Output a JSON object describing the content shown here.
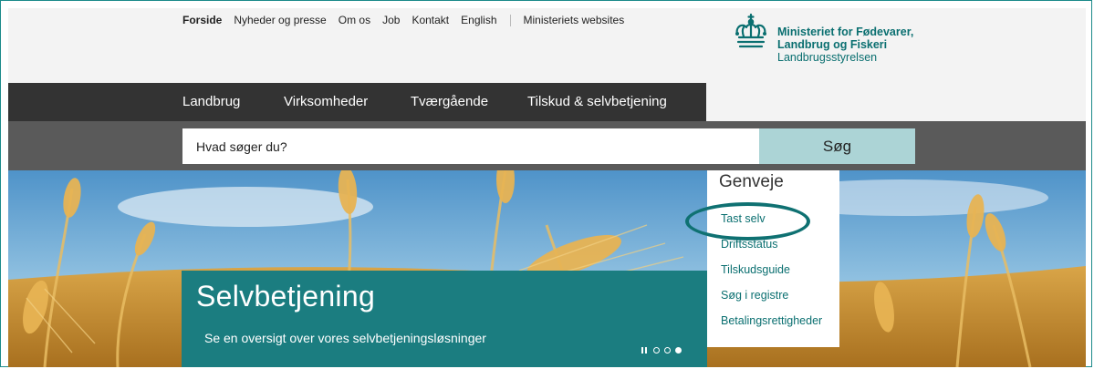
{
  "top_nav": {
    "items": [
      "Forside",
      "Nyheder og presse",
      "Om os",
      "Job",
      "Kontakt",
      "English"
    ],
    "external": "Ministeriets websites"
  },
  "logo": {
    "line1": "Ministeriet for Fødevarer,",
    "line2": "Landbrug og Fiskeri",
    "line3": "Landbrugsstyrelsen"
  },
  "main_nav": {
    "items": [
      "Landbrug",
      "Virksomheder",
      "Tværgående",
      "Tilskud & selvbetjening"
    ]
  },
  "search": {
    "placeholder": "Hvad søger du?",
    "button": "Søg"
  },
  "hero": {
    "title": "Selvbetjening",
    "subtitle": "Se en oversigt over vores selvbetjeningsløsninger",
    "slide_count": 3,
    "active_slide": 3
  },
  "shortcuts": {
    "title": "Genveje",
    "links": [
      "Tast selv",
      "Driftsstatus",
      "Tilskudsguide",
      "Søg i registre",
      "Betalingsrettigheder"
    ]
  },
  "colors": {
    "brand_teal": "#0a6f70",
    "promo_bg": "#1b7d80",
    "nav_bg": "#333333",
    "search_bg": "#5a5a5a",
    "search_button": "#acd4d6"
  }
}
